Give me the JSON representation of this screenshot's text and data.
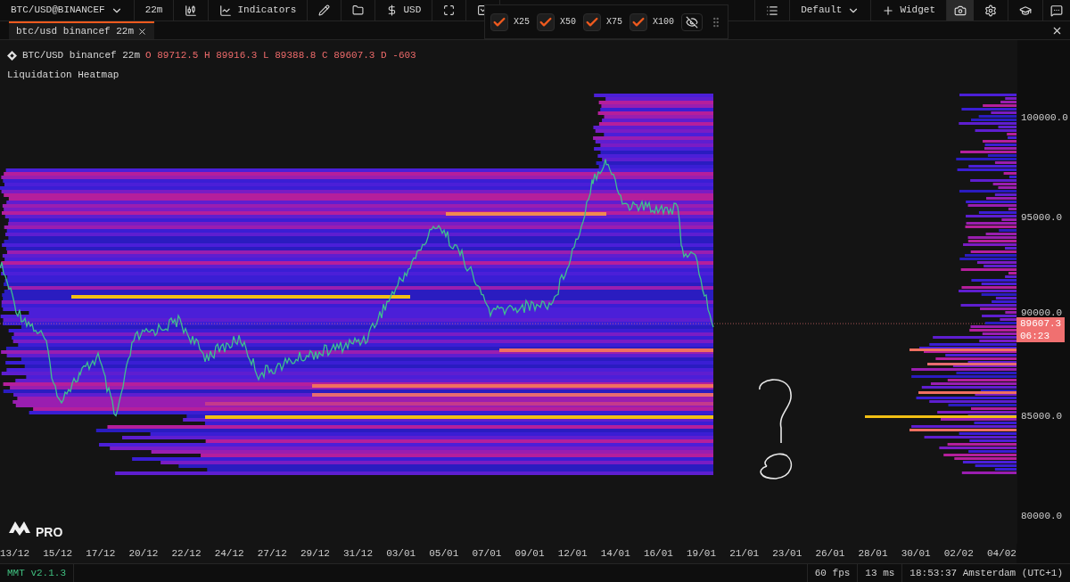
{
  "toolbar": {
    "symbol": "BTC/USD@BINANCEF",
    "interval": "22m",
    "indicators": "Indicators",
    "currency": "USD",
    "layout": "Default",
    "widget": "Widget"
  },
  "tabs": [
    {
      "label": "btc/usd binancef 22m",
      "selected": true
    }
  ],
  "leverage_filters": [
    {
      "label": "X25",
      "checked": true
    },
    {
      "label": "X50",
      "checked": true
    },
    {
      "label": "X75",
      "checked": true
    },
    {
      "label": "X100",
      "checked": true
    }
  ],
  "legend": {
    "symbol": "BTC/USD binancef 22m",
    "ohlc": "O 89712.5 H 89916.3 L 89388.8 C 89607.3 D -603",
    "indicator": "Liquidation Heatmap"
  },
  "price_axis": [
    "100000.0",
    "95000.0",
    "90000.0",
    "85000.0",
    "80000.0"
  ],
  "last_price": {
    "price": "89607.3",
    "countdown": "06:23"
  },
  "time_axis": [
    "13/12",
    "15/12",
    "17/12",
    "20/12",
    "22/12",
    "24/12",
    "27/12",
    "29/12",
    "31/12",
    "03/01",
    "05/01",
    "07/01",
    "09/01",
    "12/01",
    "14/01",
    "16/01",
    "19/01",
    "21/01",
    "23/01",
    "26/01",
    "28/01",
    "30/01",
    "02/02",
    "04/02"
  ],
  "logo": "PRO",
  "status_bar": {
    "version": "MMT v2.1.3",
    "fps": "60 fps",
    "latency": "13 ms",
    "clock": "18:53:37 Amsterdam (UTC+1)"
  }
}
